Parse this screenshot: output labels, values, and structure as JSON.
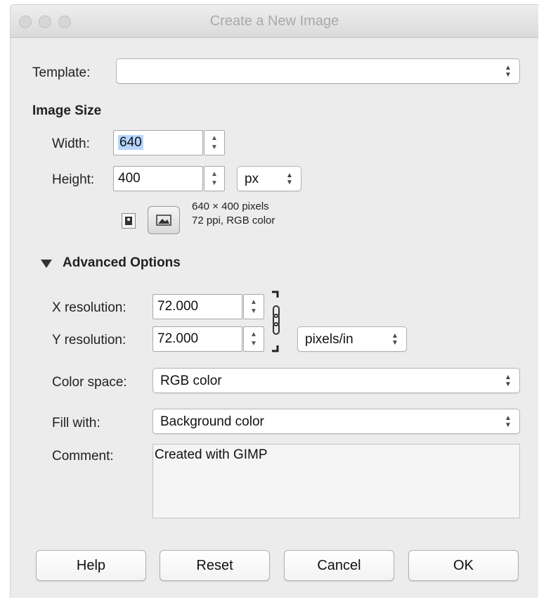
{
  "window": {
    "title": "Create a New Image"
  },
  "template": {
    "label": "Template:",
    "value": ""
  },
  "image_size": {
    "heading": "Image Size",
    "width_label": "Width:",
    "width_value": "640",
    "height_label": "Height:",
    "height_value": "400",
    "unit": "px",
    "info_line1": "640 × 400 pixels",
    "info_line2": "72 ppi, RGB color"
  },
  "advanced": {
    "heading": "Advanced Options",
    "x_res_label": "X resolution:",
    "x_res_value": "72.000",
    "y_res_label": "Y resolution:",
    "y_res_value": "72.000",
    "res_unit": "pixels/in",
    "color_space_label": "Color space:",
    "color_space_value": "RGB color",
    "fill_label": "Fill with:",
    "fill_value": "Background color",
    "comment_label": "Comment:",
    "comment_value": "Created with GIMP"
  },
  "buttons": {
    "help": "Help",
    "reset": "Reset",
    "cancel": "Cancel",
    "ok": "OK"
  },
  "icons": {
    "portrait": "portrait-orientation-icon",
    "landscape": "landscape-orientation-icon",
    "chain": "chain-link-icon",
    "disclosure": "disclosure-triangle-icon"
  }
}
